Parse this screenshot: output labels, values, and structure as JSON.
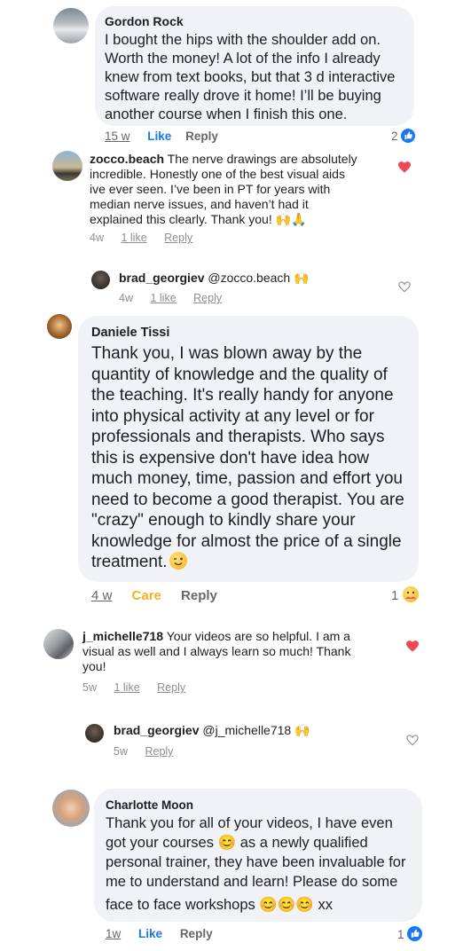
{
  "comments": [
    {
      "author": "Gordon Rock",
      "lines": [
        "I bought the hips with the shoulder add on.",
        "Worth the money!  A lot of the info I already",
        "knew from text books, but that 3 d interactive",
        "software really drove it home!   I’ll be buying",
        "another course when I finish this one."
      ],
      "time": "15 w",
      "like": "Like",
      "reply": "Reply",
      "reaction_count": "2"
    },
    {
      "author": "zocco.beach",
      "lines": [
        " The nerve drawings are absolutely",
        "incredible. Honestly one of the best visual aids",
        "ive ever seen. I’ve been in PT for years with",
        "median nerve issues, and haven’t had it",
        "explained this clearly. Thank you! 🙌🙏"
      ],
      "time": "4w",
      "likes": "1 like",
      "reply": "Reply"
    },
    {
      "author": "brad_georgiev",
      "text": " @zocco.beach 🙌",
      "time": "4w",
      "likes": "1 like",
      "reply": "Reply"
    },
    {
      "author": "Daniele Tissi",
      "lines": [
        "Thank you, I was blown away by the",
        "quantity of knowledge and the quality of",
        "the teaching. It's really handy for anyone",
        "into physical activity at any level or for",
        "professionals and therapists. Who says",
        "this is expensive don't have idea how",
        "much money, time, passion and effort you",
        "need to become a good therapist. You are",
        "\"crazy\" enough to kindly share your",
        "knowledge for almost the price of a single",
        "treatment."
      ],
      "time": "4 w",
      "care": "Care",
      "reply": "Reply",
      "reaction_count": "1"
    },
    {
      "author": "j_michelle718",
      "lines": [
        " Your videos are so helpful. I am a",
        "visual as well and I always learn so much! Thank",
        "you!"
      ],
      "time": "5w",
      "likes": "1 like",
      "reply": "Reply"
    },
    {
      "author": "brad_georgiev",
      "text": " @j_michelle718 🙌",
      "time": "5w",
      "reply": "Reply"
    },
    {
      "author": "Charlotte Moon",
      "lines": [
        "Thank you for all of your videos, I have even",
        "got your courses 😊 as a newly qualified",
        "personal trainer, they have been invaluable for",
        "me to understand and learn! Please do some",
        "face to face workshops 😊😊😊 xx"
      ],
      "time": "1w",
      "like": "Like",
      "reply": "Reply",
      "reaction_count": "1"
    }
  ],
  "colors": {
    "bubble": "#f0f2f5",
    "link_blue": "#1877f2",
    "care_yellow": "#f7b125",
    "heart_red": "#ed4956",
    "meta_gray": "#65676b"
  }
}
